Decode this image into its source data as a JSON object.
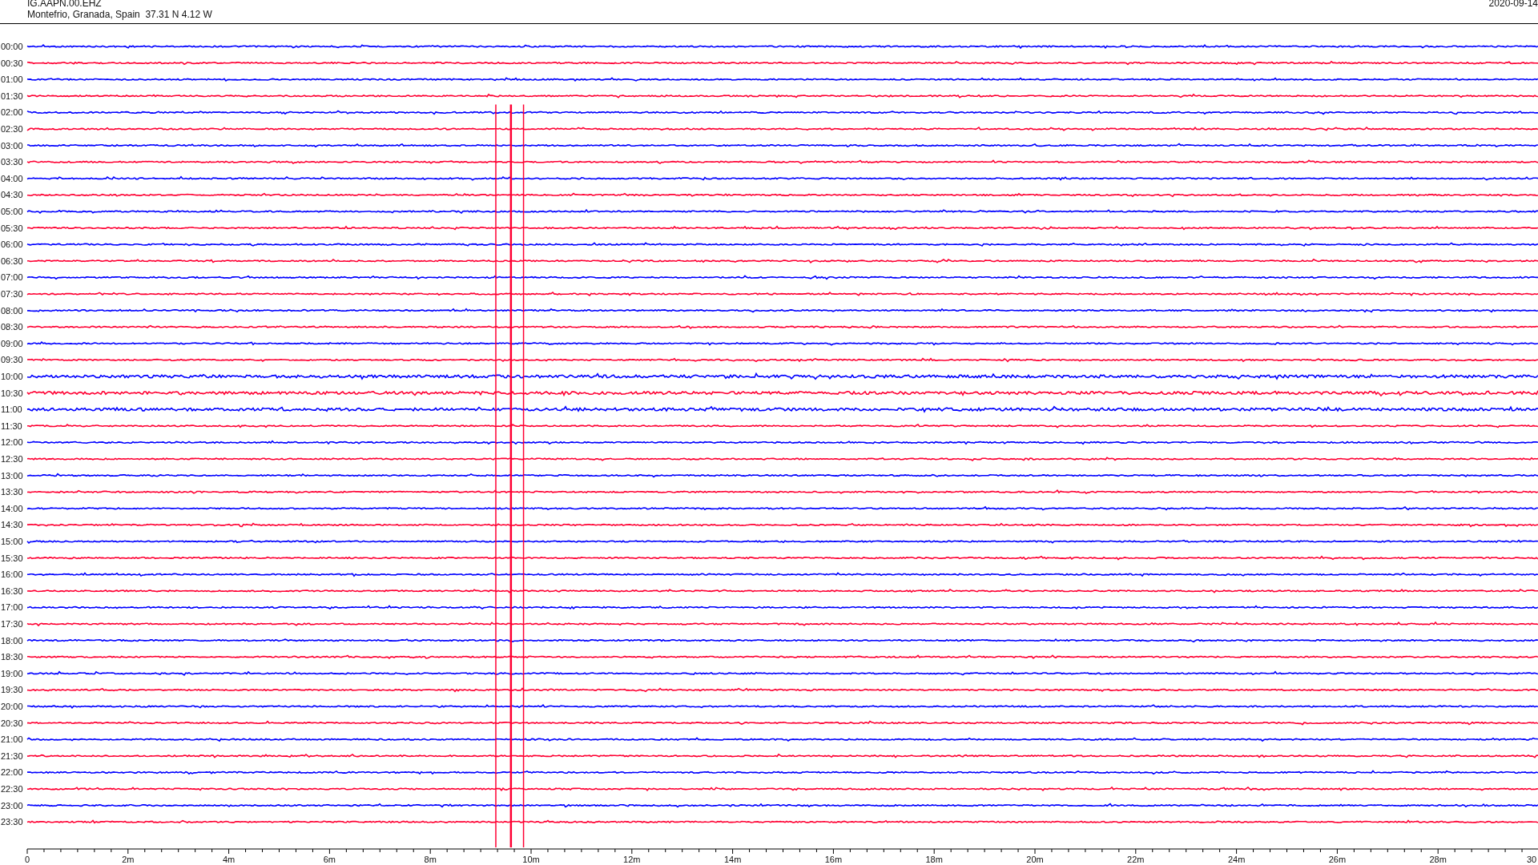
{
  "header": {
    "station": "IG.AAPN.00.EHZ",
    "location": "Montefrio, Granada, Spain  37.31 N 4.12 W",
    "date": "2020-09-14"
  },
  "traces": [
    {
      "time": "00:00",
      "color": "#0000ff"
    },
    {
      "time": "00:30",
      "color": "#ff0033"
    },
    {
      "time": "01:00",
      "color": "#0000ff"
    },
    {
      "time": "01:30",
      "color": "#ff0033"
    },
    {
      "time": "02:00",
      "color": "#0000ff"
    },
    {
      "time": "02:30",
      "color": "#ff0033"
    },
    {
      "time": "03:00",
      "color": "#0000ff"
    },
    {
      "time": "03:30",
      "color": "#ff0033"
    },
    {
      "time": "04:00",
      "color": "#0000ff"
    },
    {
      "time": "04:30",
      "color": "#ff0033"
    },
    {
      "time": "05:00",
      "color": "#0000ff"
    },
    {
      "time": "05:30",
      "color": "#ff0033"
    },
    {
      "time": "06:00",
      "color": "#0000ff"
    },
    {
      "time": "06:30",
      "color": "#ff0033"
    },
    {
      "time": "07:00",
      "color": "#0000ff"
    },
    {
      "time": "07:30",
      "color": "#ff0033"
    },
    {
      "time": "08:00",
      "color": "#0000ff"
    },
    {
      "time": "08:30",
      "color": "#ff0033"
    },
    {
      "time": "09:00",
      "color": "#0000ff"
    },
    {
      "time": "09:30",
      "color": "#ff0033"
    },
    {
      "time": "10:00",
      "color": "#0000ff"
    },
    {
      "time": "10:30",
      "color": "#ff0033"
    },
    {
      "time": "11:00",
      "color": "#0000ff"
    },
    {
      "time": "11:30",
      "color": "#ff0033"
    },
    {
      "time": "12:00",
      "color": "#0000ff"
    },
    {
      "time": "12:30",
      "color": "#ff0033"
    },
    {
      "time": "13:00",
      "color": "#0000ff"
    },
    {
      "time": "13:30",
      "color": "#ff0033"
    },
    {
      "time": "14:00",
      "color": "#0000ff"
    },
    {
      "time": "14:30",
      "color": "#ff0033"
    },
    {
      "time": "15:00",
      "color": "#0000ff"
    },
    {
      "time": "15:30",
      "color": "#ff0033"
    },
    {
      "time": "16:00",
      "color": "#0000ff"
    },
    {
      "time": "16:30",
      "color": "#ff0033"
    },
    {
      "time": "17:00",
      "color": "#0000ff"
    },
    {
      "time": "17:30",
      "color": "#ff0033"
    },
    {
      "time": "18:00",
      "color": "#0000ff"
    },
    {
      "time": "18:30",
      "color": "#ff0033"
    },
    {
      "time": "19:00",
      "color": "#0000ff"
    },
    {
      "time": "19:30",
      "color": "#ff0033"
    },
    {
      "time": "20:00",
      "color": "#0000ff"
    },
    {
      "time": "20:30",
      "color": "#ff0033"
    },
    {
      "time": "21:00",
      "color": "#0000ff"
    },
    {
      "time": "21:30",
      "color": "#ff0033"
    },
    {
      "time": "22:00",
      "color": "#0000ff"
    },
    {
      "time": "22:30",
      "color": "#ff0033"
    },
    {
      "time": "23:00",
      "color": "#0000ff"
    },
    {
      "time": "23:30",
      "color": "#ff0033"
    }
  ],
  "x_axis": {
    "ticks": [
      "0",
      "2m",
      "4m",
      "6m",
      "8m",
      "10m",
      "12m",
      "14m",
      "16m",
      "18m",
      "20m",
      "22m",
      "24m",
      "26m",
      "28m",
      "30"
    ]
  }
}
